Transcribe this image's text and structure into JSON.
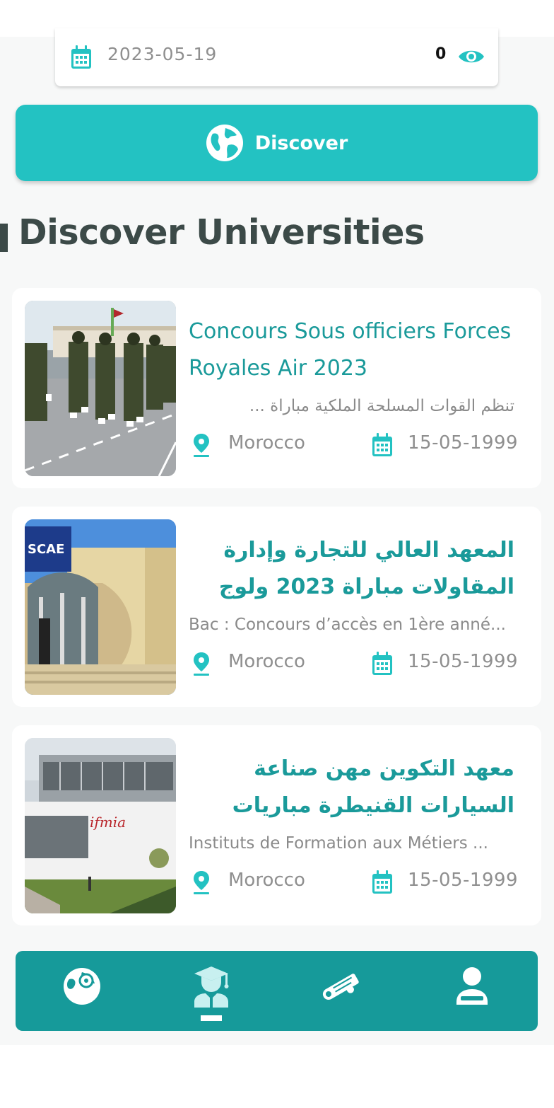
{
  "top_card": {
    "date": "2023-05-19",
    "views": "0",
    "icons": {
      "calendar": "calendar-icon",
      "views": "eye-icon"
    }
  },
  "discover_button": {
    "label": "Discover",
    "icon": "globe-icon"
  },
  "section": {
    "title": "Discover Universities"
  },
  "cards": [
    {
      "title": "Concours Sous officiers Forces Royales Air 2023",
      "description": "تنظم القوات المسلحة الملكية مباراة ...",
      "location": "Morocco",
      "date": "15-05-1999"
    },
    {
      "title": "المعهد العالي للتجارة وإدارة المقاولات مباراة 2023 ولوج",
      "description": "Bac : Concours d’accès en 1ère anné...",
      "location": "Morocco",
      "date": "15-05-1999"
    },
    {
      "title": "معهد التكوين مهن صناعة السيارات القنيطرة مباريات ولوج",
      "description": "Instituts de Formation aux Métiers ...",
      "location": "Morocco",
      "date": "15-05-1999"
    }
  ],
  "bottom_nav": {
    "items": [
      "globe-nav-icon",
      "graduate-icon",
      "diploma-icon",
      "user-icon"
    ],
    "active_index": 1
  },
  "colors": {
    "accent": "#23c2c2",
    "nav": "#169a9a",
    "title_teal": "#1a9a9a",
    "heading": "#3c4a48"
  }
}
